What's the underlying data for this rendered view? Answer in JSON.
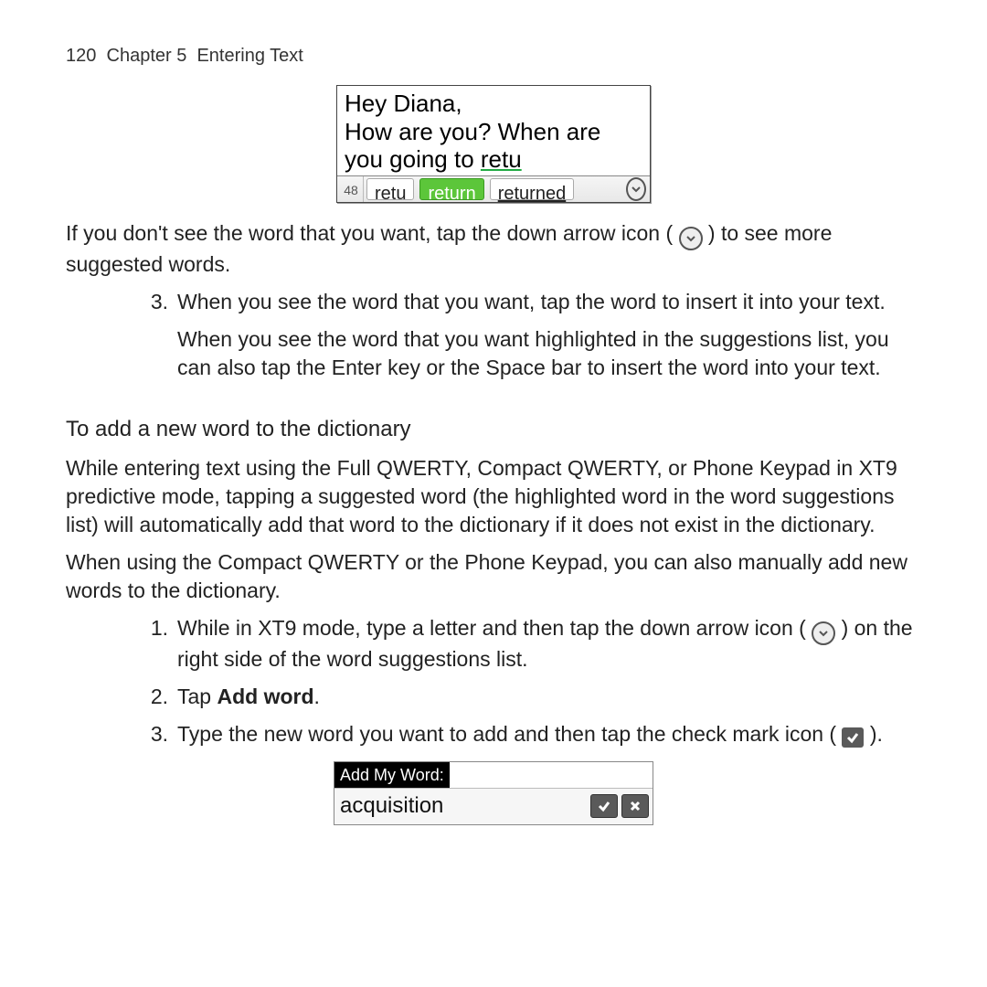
{
  "header": {
    "page_num": "120",
    "chapter": "Chapter 5",
    "title": "Entering Text"
  },
  "shot1": {
    "line1": "Hey Diana,",
    "line2": "How are you? When are",
    "line3a": "you going to ",
    "line3b": "retu",
    "count": "48",
    "sugg1": "retu",
    "sugg2": "return",
    "sugg3": "returned"
  },
  "body": {
    "p1a": "If you don't see the word that you want, tap the down arrow icon ( ",
    "p1b": " ) to see more suggested words.",
    "step3_num": "3.",
    "step3_a": "When you see the word that you want, tap the word to insert it into your text.",
    "step3_b": "When you see the word that you want highlighted in the suggestions list, you can also tap the Enter key or the Space bar to insert the word into your text.",
    "subhead": "To add a new word to the dictionary",
    "p2": "While entering text using the Full QWERTY, Compact QWERTY, or Phone Keypad in XT9 predictive mode, tapping a suggested word (the highlighted word in the word suggestions list) will automatically add that word to the dictionary if it does not exist in the dictionary.",
    "p3": "When using the Compact QWERTY or the Phone Keypad, you can also manually add new words to the dictionary.",
    "add1_num": "1.",
    "add1_a": "While in XT9 mode, type a letter and then tap the down arrow icon ( ",
    "add1_b": " ) on the right side of the word suggestions list.",
    "add2_num": "2.",
    "add2_a": "Tap ",
    "add2_b": "Add word",
    "add2_c": ".",
    "add3_num": "3.",
    "add3_a": "Type the new word you want to add and then tap the check mark icon ( ",
    "add3_b": " )."
  },
  "shot2": {
    "title": "Add My Word:",
    "input": "acquisition"
  }
}
